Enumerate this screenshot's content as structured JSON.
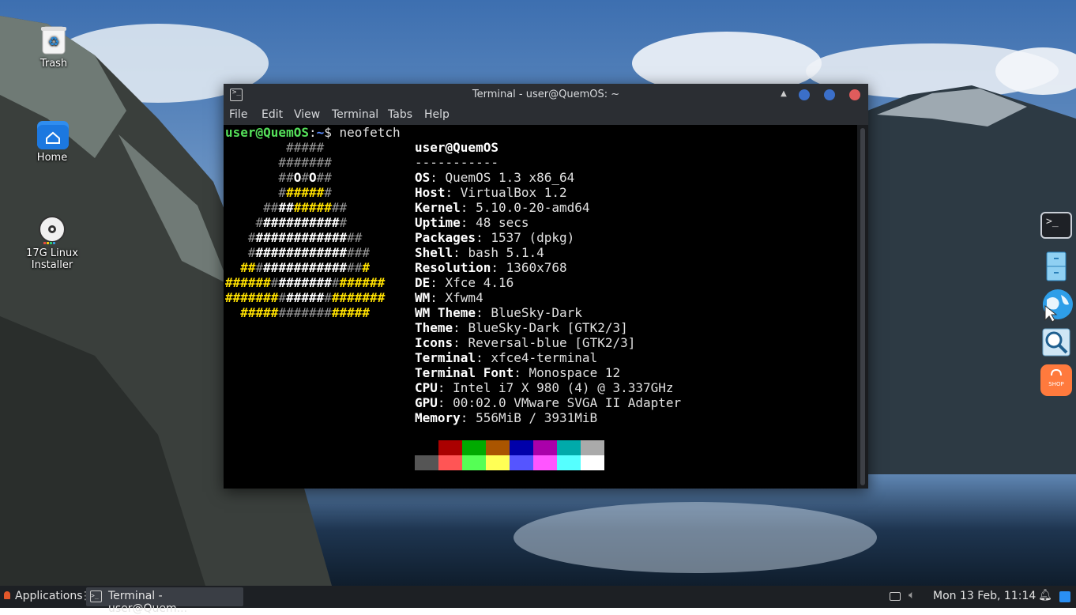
{
  "desktop": {
    "icons": [
      {
        "label": "Trash",
        "icon": "trash-icon"
      },
      {
        "label": "Home",
        "icon": "home-folder-icon"
      },
      {
        "label_line1": "17G Linux",
        "label_line2": "Installer",
        "icon": "installer-disc-icon"
      }
    ]
  },
  "window": {
    "title": "Terminal - user@QuemOS: ~",
    "menu": [
      "File",
      "Edit",
      "View",
      "Terminal",
      "Tabs",
      "Help"
    ],
    "prompt_user": "user@QuemOS",
    "prompt_sep": ":",
    "prompt_path": "~",
    "prompt_symbol": "$",
    "command": "neofetch",
    "header": "user@QuemOS",
    "separator": "-----------",
    "info": [
      {
        "key": "OS",
        "value": "QuemOS 1.3 x86_64"
      },
      {
        "key": "Host",
        "value": "VirtualBox 1.2"
      },
      {
        "key": "Kernel",
        "value": "5.10.0-20-amd64"
      },
      {
        "key": "Uptime",
        "value": "48 secs"
      },
      {
        "key": "Packages",
        "value": "1537 (dpkg)"
      },
      {
        "key": "Shell",
        "value": "bash 5.1.4"
      },
      {
        "key": "Resolution",
        "value": "1360x768"
      },
      {
        "key": "DE",
        "value": "Xfce 4.16"
      },
      {
        "key": "WM",
        "value": "Xfwm4"
      },
      {
        "key": "WM Theme",
        "value": "BlueSky-Dark"
      },
      {
        "key": "Theme",
        "value": "BlueSky-Dark [GTK2/3]"
      },
      {
        "key": "Icons",
        "value": "Reversal-blue [GTK2/3]"
      },
      {
        "key": "Terminal",
        "value": "xfce4-terminal"
      },
      {
        "key": "Terminal Font",
        "value": "Monospace 12"
      },
      {
        "key": "CPU",
        "value": "Intel i7 X 980 (4) @ 3.337GHz"
      },
      {
        "key": "GPU",
        "value": "00:02.0 VMware SVGA II Adapter"
      },
      {
        "key": "Memory",
        "value": "556MiB / 3931MiB"
      }
    ],
    "palette_top": [
      "#000000",
      "#aa0000",
      "#00aa00",
      "#aa5500",
      "#0000aa",
      "#aa00aa",
      "#00aaaa",
      "#aaaaaa"
    ],
    "palette_bottom": [
      "#555555",
      "#ff5555",
      "#55ff55",
      "#ffff55",
      "#5555ff",
      "#ff55ff",
      "#55ffff",
      "#ffffff"
    ],
    "logo": [
      [
        [
          "g",
          "        #####"
        ]
      ],
      [
        [
          "g",
          "       #######"
        ]
      ],
      [
        [
          "g",
          "       ##"
        ],
        [
          "w",
          "O"
        ],
        [
          "g",
          "#"
        ],
        [
          "w",
          "O"
        ],
        [
          "g",
          "##"
        ]
      ],
      [
        [
          "g",
          "       #"
        ],
        [
          "y",
          "#####"
        ],
        [
          "g",
          "#"
        ]
      ],
      [
        [
          "g",
          "     ##"
        ],
        [
          "w",
          "##"
        ],
        [
          "y",
          "#####"
        ],
        [
          "g",
          "##"
        ]
      ],
      [
        [
          "g",
          "    #"
        ],
        [
          "w",
          "##########"
        ],
        [
          "g",
          "#"
        ]
      ],
      [
        [
          "g",
          "   #"
        ],
        [
          "w",
          "############"
        ],
        [
          "g",
          "##"
        ]
      ],
      [
        [
          "g",
          "   #"
        ],
        [
          "w",
          "############"
        ],
        [
          "g",
          "###"
        ]
      ],
      [
        [
          "g",
          "  "
        ],
        [
          "y",
          "##"
        ],
        [
          "g",
          "#"
        ],
        [
          "w",
          "###########"
        ],
        [
          "g",
          "##"
        ],
        [
          "y",
          "#"
        ]
      ],
      [
        [
          "y",
          "######"
        ],
        [
          "g",
          "#"
        ],
        [
          "w",
          "#######"
        ],
        [
          "g",
          "#"
        ],
        [
          "y",
          "######"
        ]
      ],
      [
        [
          "y",
          "#######"
        ],
        [
          "g",
          "#"
        ],
        [
          "w",
          "#####"
        ],
        [
          "g",
          "#"
        ],
        [
          "y",
          "#######"
        ]
      ],
      [
        [
          "g",
          "  "
        ],
        [
          "y",
          "#####"
        ],
        [
          "g",
          "#######"
        ],
        [
          "y",
          "#####"
        ]
      ]
    ]
  },
  "taskbar": {
    "apps_label": "Applications",
    "task_label": "Terminal - user@Quem...",
    "clock": "Mon 13 Feb, 11:14"
  },
  "dock": {
    "items": [
      "terminal-icon",
      "file-cabinet-icon",
      "web-browser-icon",
      "search-icon",
      "shop-icon"
    ],
    "shop_label": "SHOP"
  }
}
